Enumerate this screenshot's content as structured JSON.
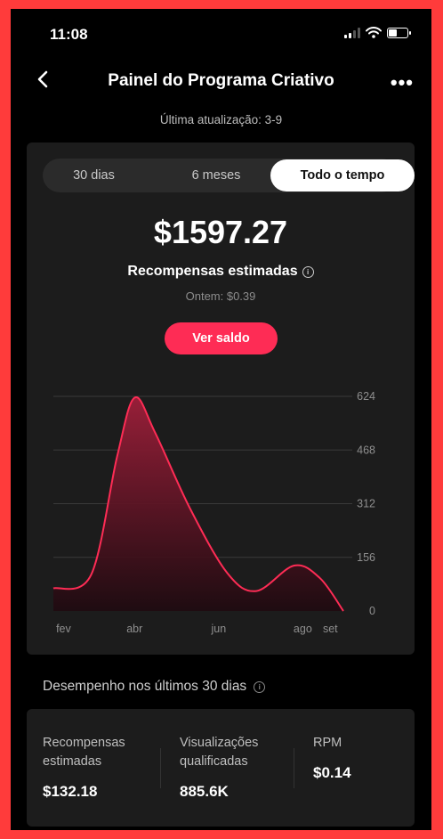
{
  "status_bar": {
    "time": "11:08"
  },
  "header": {
    "title": "Painel do Programa Criativo",
    "more": "•••",
    "updated": "Última atualização: 3-9"
  },
  "tabs": [
    {
      "label": "30 dias",
      "selected": false
    },
    {
      "label": "6 meses",
      "selected": false
    },
    {
      "label": "Todo o tempo",
      "selected": true
    }
  ],
  "summary": {
    "amount": "$1597.27",
    "label": "Recompensas estimadas",
    "info_icon": "i",
    "yesterday": "Ontem: $0.39",
    "button": "Ver saldo"
  },
  "chart_data": {
    "type": "area",
    "x_tick_labels": [
      "fev",
      "abr",
      "jun",
      "ago",
      "set"
    ],
    "y_ticks": [
      0,
      156,
      312,
      468,
      624
    ],
    "ylim": [
      0,
      624
    ],
    "points": [
      {
        "x": 0.0,
        "y": 66
      },
      {
        "x": 0.13,
        "y": 105
      },
      {
        "x": 0.22,
        "y": 450
      },
      {
        "x": 0.28,
        "y": 620
      },
      {
        "x": 0.35,
        "y": 520
      },
      {
        "x": 0.47,
        "y": 300
      },
      {
        "x": 0.6,
        "y": 110
      },
      {
        "x": 0.7,
        "y": 58
      },
      {
        "x": 0.83,
        "y": 132
      },
      {
        "x": 0.92,
        "y": 95
      },
      {
        "x": 1.0,
        "y": 0
      }
    ],
    "colors": {
      "line": "#fe2c55",
      "fill_top": "#9e1f3a",
      "fill_bottom": "#1f0a10",
      "grid": "#3a3a3a"
    },
    "grid": true
  },
  "performance": {
    "title": "Desempenho nos últimos 30 dias",
    "info_icon": "i",
    "metrics": [
      {
        "label": "Recompensas estimadas",
        "value": "$132.18"
      },
      {
        "label": "Visualizações qualificadas",
        "value": "885.6K"
      },
      {
        "label": "RPM",
        "value": "$0.14"
      }
    ]
  },
  "colors": {
    "accent": "#fe2c55",
    "background": "#000000",
    "card": "#1c1c1c",
    "frame": "#ff3b3b"
  }
}
